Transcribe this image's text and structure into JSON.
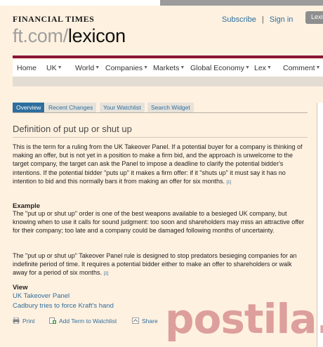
{
  "masthead": "FINANCIAL TIMES",
  "top_links": {
    "subscribe": "Subscribe",
    "separator": "|",
    "signin": "Sign in"
  },
  "lex_tab": "Lexi",
  "logo": {
    "prefix": "ft.com/",
    "name": "lexicon"
  },
  "nav": [
    {
      "label": "Home",
      "caret": false
    },
    {
      "label": "UK",
      "caret": true
    },
    {
      "label": "World",
      "caret": true
    },
    {
      "label": "Companies",
      "caret": true
    },
    {
      "label": "Markets",
      "caret": true
    },
    {
      "label": "Global Economy",
      "caret": true
    },
    {
      "label": "Lex",
      "caret": true
    },
    {
      "label": "Comment",
      "caret": true
    }
  ],
  "tabs": [
    "Overview",
    "Recent Changes",
    "Your Watchlist",
    "Search Widget"
  ],
  "definition_title": "Definition of put up or shut up",
  "para1": "This is the term for a ruling from the UK Takeover Panel. If a potential buyer for a company is thinking of making an offer, but is not yet in a position to make a firm bid, and the approach is unwelcome to the target company, the target can ask the Panel to impose a deadline to clarify the potential bidder's intentions. If the potential bidder \"puts up\" it makes a firm offer: if it \"shuts up\" it must say it has no intention to bid and this normally bars it from making an offer for six months.",
  "ref1": "[1]",
  "example_heading": "Example",
  "para2": "The \"put up or shut up\" order is one of the best weapons available to a besieged UK company, but knowing when to use it calls for sound judgment: too soon and shareholders may miss an attractive offer for their company; too late and a company could be damaged following months of uncertainty.",
  "para3": "The \"put up or shut up\" Takeover Panel rule is designed to stop predators besieging companies for an indefinite period of time. It requires a potential bidder either to make an offer to shareholders or walk away for a period of six months.",
  "ref2": "[2]",
  "view_heading": "View",
  "view_links": [
    "UK Takeover Panel",
    "Cadbury tries to force Kraft's hand"
  ],
  "actions": {
    "print": "Print",
    "watchlist": "Add Term to Watchlist",
    "share": "Share"
  },
  "icons": {
    "print": "print-icon",
    "watchlist": "add-watchlist-icon",
    "share": "share-icon"
  },
  "watermark": "postila.ru",
  "colors": {
    "background": "#fff1e0",
    "accent_red": "#8a1436",
    "link_blue": "#2e6e9e"
  }
}
